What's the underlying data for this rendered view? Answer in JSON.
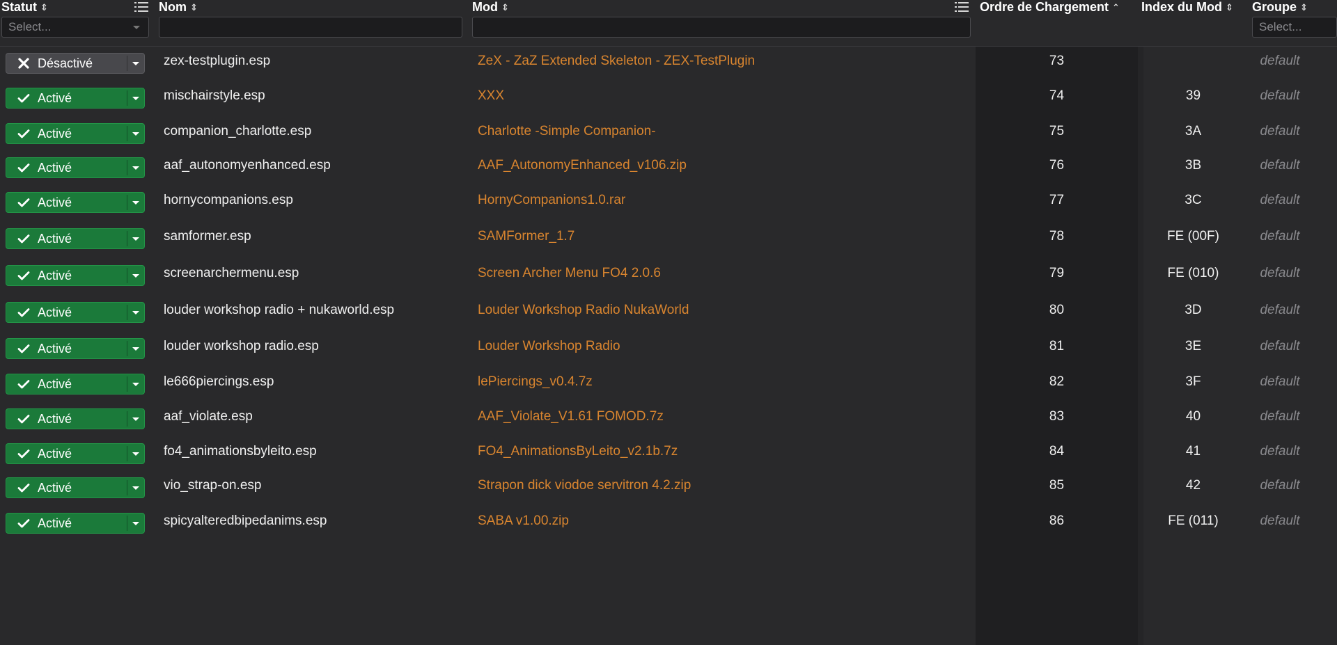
{
  "columns": {
    "statut": {
      "label": "Statut",
      "sort_icon": "sort-both-icon",
      "filter_placeholder": "Select..."
    },
    "nom": {
      "label": "Nom",
      "sort_icon": "sort-both-icon",
      "filter_value": ""
    },
    "mod": {
      "label": "Mod",
      "sort_icon": "sort-both-icon",
      "filter_value": ""
    },
    "ordre": {
      "label": "Ordre de Chargement",
      "sort_icon": "sort-ascending-icon"
    },
    "index": {
      "label": "Index du Mod",
      "sort_icon": "sort-both-icon"
    },
    "groupe": {
      "label": "Groupe",
      "sort_icon": "sort-both-icon",
      "filter_placeholder": "Select..."
    }
  },
  "status_labels": {
    "on": "Activé",
    "off": "Désactivé"
  },
  "colors": {
    "enabled": "#1b7a3a",
    "disabled": "#48484c",
    "mod_link": "#d9852f",
    "background": "#29292b"
  },
  "rows": [
    {
      "status": "off",
      "name": "zex-testplugin.esp",
      "mod": "ZeX - ZaZ Extended Skeleton - ZEX-TestPlugin",
      "order": "73",
      "index": "",
      "group": "default"
    },
    {
      "status": "on",
      "name": "mischairstyle.esp",
      "mod": "XXX",
      "order": "74",
      "index": "39",
      "group": "default"
    },
    {
      "status": "on",
      "name": "companion_charlotte.esp",
      "mod": "Charlotte -Simple Companion-",
      "order": "75",
      "index": "3A",
      "group": "default"
    },
    {
      "status": "on",
      "name": "aaf_autonomyenhanced.esp",
      "mod": "AAF_AutonomyEnhanced_v106.zip",
      "order": "76",
      "index": "3B",
      "group": "default"
    },
    {
      "status": "on",
      "name": "hornycompanions.esp",
      "mod": "HornyCompanions1.0.rar",
      "order": "77",
      "index": "3C",
      "group": "default"
    },
    {
      "status": "on",
      "name": "samformer.esp",
      "mod": "SAMFormer_1.7",
      "order": "78",
      "index": "FE (00F)",
      "group": "default"
    },
    {
      "status": "on",
      "name": "screenarchermenu.esp",
      "mod": "Screen Archer Menu FO4 2.0.6",
      "order": "79",
      "index": "FE (010)",
      "group": "default"
    },
    {
      "status": "on",
      "name": "louder workshop radio + nukaworld.esp",
      "mod": "Louder Workshop Radio NukaWorld",
      "order": "80",
      "index": "3D",
      "group": "default"
    },
    {
      "status": "on",
      "name": "louder workshop radio.esp",
      "mod": "Louder Workshop Radio",
      "order": "81",
      "index": "3E",
      "group": "default"
    },
    {
      "status": "on",
      "name": "le666piercings.esp",
      "mod": "lePiercings_v0.4.7z",
      "order": "82",
      "index": "3F",
      "group": "default"
    },
    {
      "status": "on",
      "name": "aaf_violate.esp",
      "mod": "AAF_Violate_V1.61 FOMOD.7z",
      "order": "83",
      "index": "40",
      "group": "default"
    },
    {
      "status": "on",
      "name": "fo4_animationsbyleito.esp",
      "mod": "FO4_AnimationsByLeito_v2.1b.7z",
      "order": "84",
      "index": "41",
      "group": "default"
    },
    {
      "status": "on",
      "name": "vio_strap-on.esp",
      "mod": "Strapon dick viodoe servitron 4.2.zip",
      "order": "85",
      "index": "42",
      "group": "default"
    },
    {
      "status": "on",
      "name": "spicyalteredbipedanims.esp",
      "mod": "SABA v1.00.zip",
      "order": "86",
      "index": "FE (011)",
      "group": "default"
    }
  ]
}
